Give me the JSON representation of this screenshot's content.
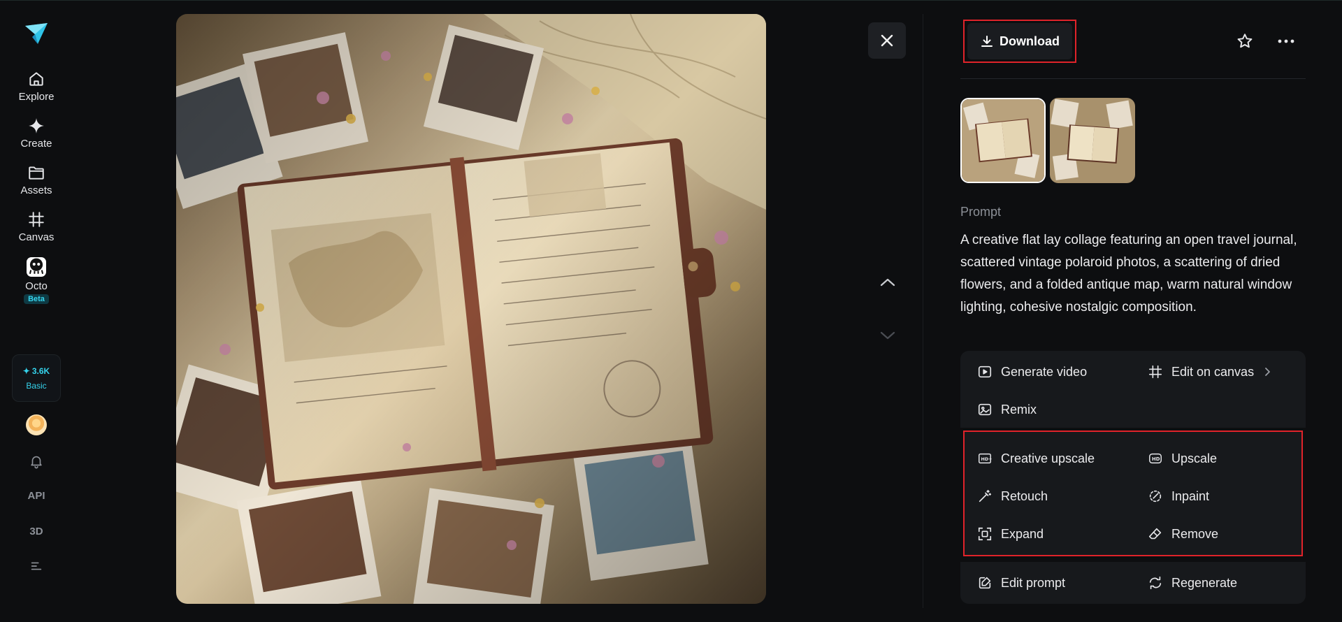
{
  "sidebar": {
    "items": [
      {
        "label": "Explore",
        "icon": "home-icon"
      },
      {
        "label": "Create",
        "icon": "sparkle-icon"
      },
      {
        "label": "Assets",
        "icon": "folder-icon"
      },
      {
        "label": "Canvas",
        "icon": "canvas-icon"
      },
      {
        "label": "Octo",
        "icon": "octo-icon",
        "badge": "Beta"
      }
    ],
    "credits": {
      "amount": "3.6K",
      "plan": "Basic"
    },
    "api_label": "API",
    "threed_label": "3D"
  },
  "panel": {
    "download_label": "Download",
    "prompt_label": "Prompt",
    "prompt_text": "A creative flat lay collage featuring an open travel journal, scattered vintage polaroid photos, a scattering of dried flowers, and a folded antique map, warm natural window lighting, cohesive nostalgic composition.",
    "actions": {
      "generate_video": "Generate video",
      "edit_on_canvas": "Edit on canvas",
      "remix": "Remix",
      "creative_upscale": "Creative upscale",
      "upscale": "Upscale",
      "retouch": "Retouch",
      "inpaint": "Inpaint",
      "expand": "Expand",
      "remove": "Remove",
      "edit_prompt": "Edit prompt",
      "regenerate": "Regenerate"
    }
  },
  "colors": {
    "background": "#0d0e10",
    "accent_cyan": "#35d3ec",
    "highlight_red": "#e0232a",
    "panel_bg": "#17191c"
  }
}
